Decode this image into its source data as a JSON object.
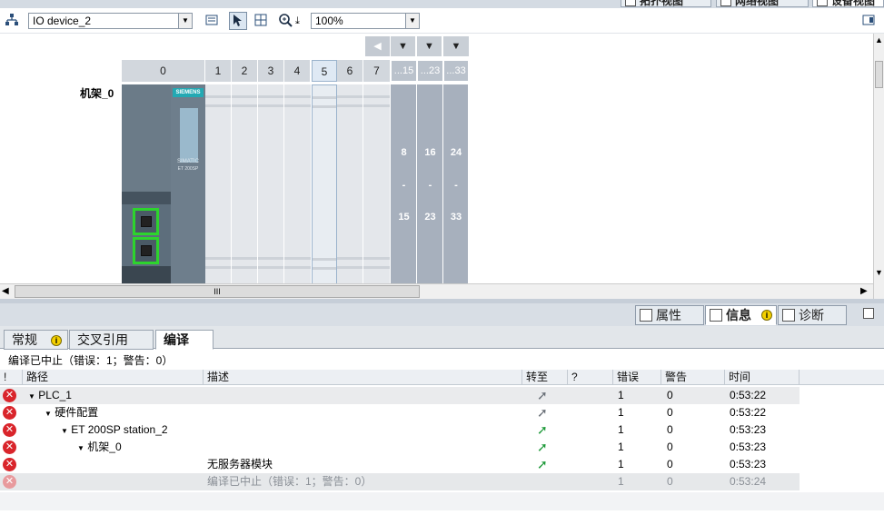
{
  "view_tabs": [
    {
      "label": "拓扑视图"
    },
    {
      "label": "网络视图"
    },
    {
      "label": "设备视图"
    }
  ],
  "toolbar": {
    "device_select": "IO device_2",
    "zoom_select": "100%"
  },
  "rack": {
    "name": "机架_0",
    "slots": [
      "0",
      "1",
      "2",
      "3",
      "4",
      "5",
      "6",
      "7"
    ],
    "groups": [
      {
        "header": "...15",
        "from": "8",
        "dash": "-",
        "to": "15"
      },
      {
        "header": "...23",
        "from": "16",
        "dash": "-",
        "to": "23"
      },
      {
        "header": "...33",
        "from": "24",
        "dash": "-",
        "to": "33"
      }
    ],
    "module_brand": "SIEMENS",
    "module_line1": "SIMATIC",
    "module_line2": "ET 200SP"
  },
  "scroll": {
    "thumb_glyph": "III"
  },
  "inspector_tabs": [
    {
      "label": "属性"
    },
    {
      "label": "信息"
    },
    {
      "label": "诊断"
    }
  ],
  "info_badge": "i",
  "sub_tabs": [
    {
      "label": "常规"
    },
    {
      "label": "交叉引用"
    },
    {
      "label": "编译"
    }
  ],
  "status_text": "编译已中止（错误：1；警告：0）",
  "columns": {
    "flag": "!",
    "path": "路径",
    "desc": "描述",
    "goto": "转至",
    "q": "?",
    "errors": "错误",
    "warnings": "警告",
    "time": "时间"
  },
  "rows": [
    {
      "path": "PLC_1",
      "desc": "",
      "errors": "1",
      "warnings": "0",
      "time": "0:53:22"
    },
    {
      "path": "硬件配置",
      "desc": "",
      "errors": "1",
      "warnings": "0",
      "time": "0:53:22"
    },
    {
      "path": "ET 200SP station_2",
      "desc": "",
      "errors": "1",
      "warnings": "0",
      "time": "0:53:23"
    },
    {
      "path": "机架_0",
      "desc": "",
      "errors": "1",
      "warnings": "0",
      "time": "0:53:23"
    },
    {
      "path": "",
      "desc": "无服务器模块",
      "errors": "1",
      "warnings": "0",
      "time": "0:53:23"
    },
    {
      "path": "",
      "desc": "编译已中止（错误：1；警告：0）",
      "errors": "1",
      "warnings": "0",
      "time": "0:53:24"
    }
  ],
  "colors": {
    "error": "#d9252b",
    "goto_green": "#1f9a3a",
    "goto_gray": "#6a7078",
    "port_green": "#2dd42d"
  }
}
